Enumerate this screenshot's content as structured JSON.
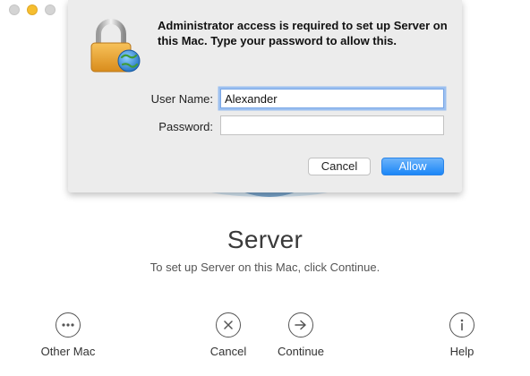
{
  "window": {
    "traffic_lights": [
      "close",
      "minimize",
      "zoom"
    ]
  },
  "app": {
    "title": "Server",
    "subtitle": "To set up Server on this Mac, click Continue."
  },
  "actions": [
    {
      "label": "Other Mac",
      "icon": "ellipsis-circle-icon"
    },
    {
      "label": "Cancel",
      "icon": "x-circle-icon"
    },
    {
      "label": "Continue",
      "icon": "arrow-right-circle-icon"
    },
    {
      "label": "Help",
      "icon": "info-circle-icon"
    }
  ],
  "dialog": {
    "icon": "padlock-globe-icon",
    "message": "Administrator access is required to set up Server on this Mac. Type your password to allow this.",
    "user_name_label": "User Name:",
    "user_name_value": "Alexander",
    "password_label": "Password:",
    "password_value": "",
    "cancel_label": "Cancel",
    "allow_label": "Allow"
  },
  "colors": {
    "accent": "#1b86f7",
    "focus_ring": "#9cc0f0",
    "sheet_bg": "#ececec",
    "minimize_light": "#f6be2f"
  }
}
